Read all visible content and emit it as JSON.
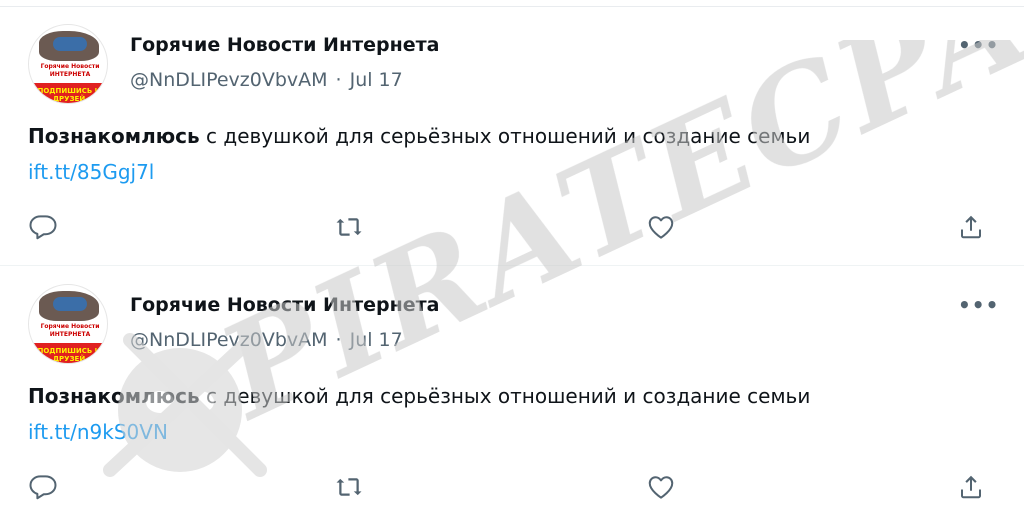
{
  "tweets": [
    {
      "display_name": "Горячие Новости Интернета",
      "handle": "@NnDLIPevz0VbvAM",
      "date": "Jul 17",
      "text_bold": "Познакомлюсь",
      "text_rest": " с девушкой для серьёзных отношений и создание семьи",
      "link": "ift.tt/85Ggj7l",
      "more": "•••",
      "avatar_text": {
        "line1": "Горячие Новости",
        "line2": "ИНТЕРНЕТА",
        "line3": "ПОДПИШИСЬ И ДРУЗЕЙ"
      }
    },
    {
      "display_name": "Горячие Новости Интернета",
      "handle": "@NnDLIPevz0VbvAM",
      "date": "Jul 17",
      "text_bold": "Познакомлюсь",
      "text_rest": " с девушкой для серьёзных отношений и создание семьи",
      "link": "ift.tt/n9kS0VN",
      "more": "•••",
      "avatar_text": {
        "line1": "Горячие Новости",
        "line2": "ИНТЕРНЕТА",
        "line3": "ПОДПИШИСЬ И ДРУЗЕЙ"
      }
    }
  ],
  "separator": "·",
  "watermark_text": "PIRATECPA",
  "colors": {
    "link": "#1d9bf0",
    "secondary": "#536471",
    "primary": "#0f1419",
    "watermark": "#cfcfcf"
  },
  "icons": [
    "reply-icon",
    "retweet-icon",
    "like-icon",
    "share-icon",
    "more-icon"
  ]
}
